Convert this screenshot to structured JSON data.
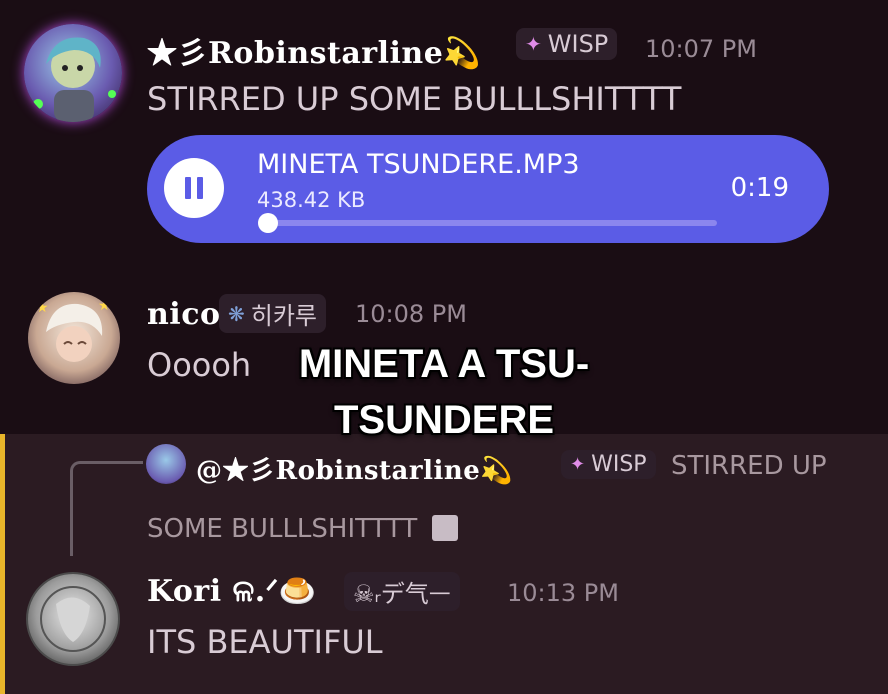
{
  "messages": [
    {
      "username": "★彡Robinstarline💫",
      "tag": "WISP",
      "time": "10:07 PM",
      "text": "STIRRED UP SOME BULLLSHITTTT",
      "attachment": {
        "file_name": "MINETA TSUNDERE.MP3",
        "file_size": "438.42 KB",
        "duration": "0:19",
        "progress": 0.02,
        "state": "playing"
      }
    },
    {
      "username": "nico",
      "tag": "히카루",
      "time": "10:08 PM",
      "text": "Ooooh"
    },
    {
      "reply": {
        "mention": "@★彡Robinstarline💫",
        "tag": "WISP",
        "preview_line1": "STIRRED UP",
        "preview_line2": "SOME BULLLSHITTTT"
      },
      "username": "Kori ଳ.ᐟ🍮",
      "tag": "☠︎ᵣデ气ᅳ",
      "time": "10:13 PM",
      "text": "ITS BEAUTIFUL"
    }
  ],
  "caption": {
    "line1": "MINETA A TSU-",
    "line2": "TSUNDERE"
  },
  "colors": {
    "background": "#1a0d14",
    "player": "#5b5ce6",
    "highlight_bar": "#e8b52a"
  }
}
